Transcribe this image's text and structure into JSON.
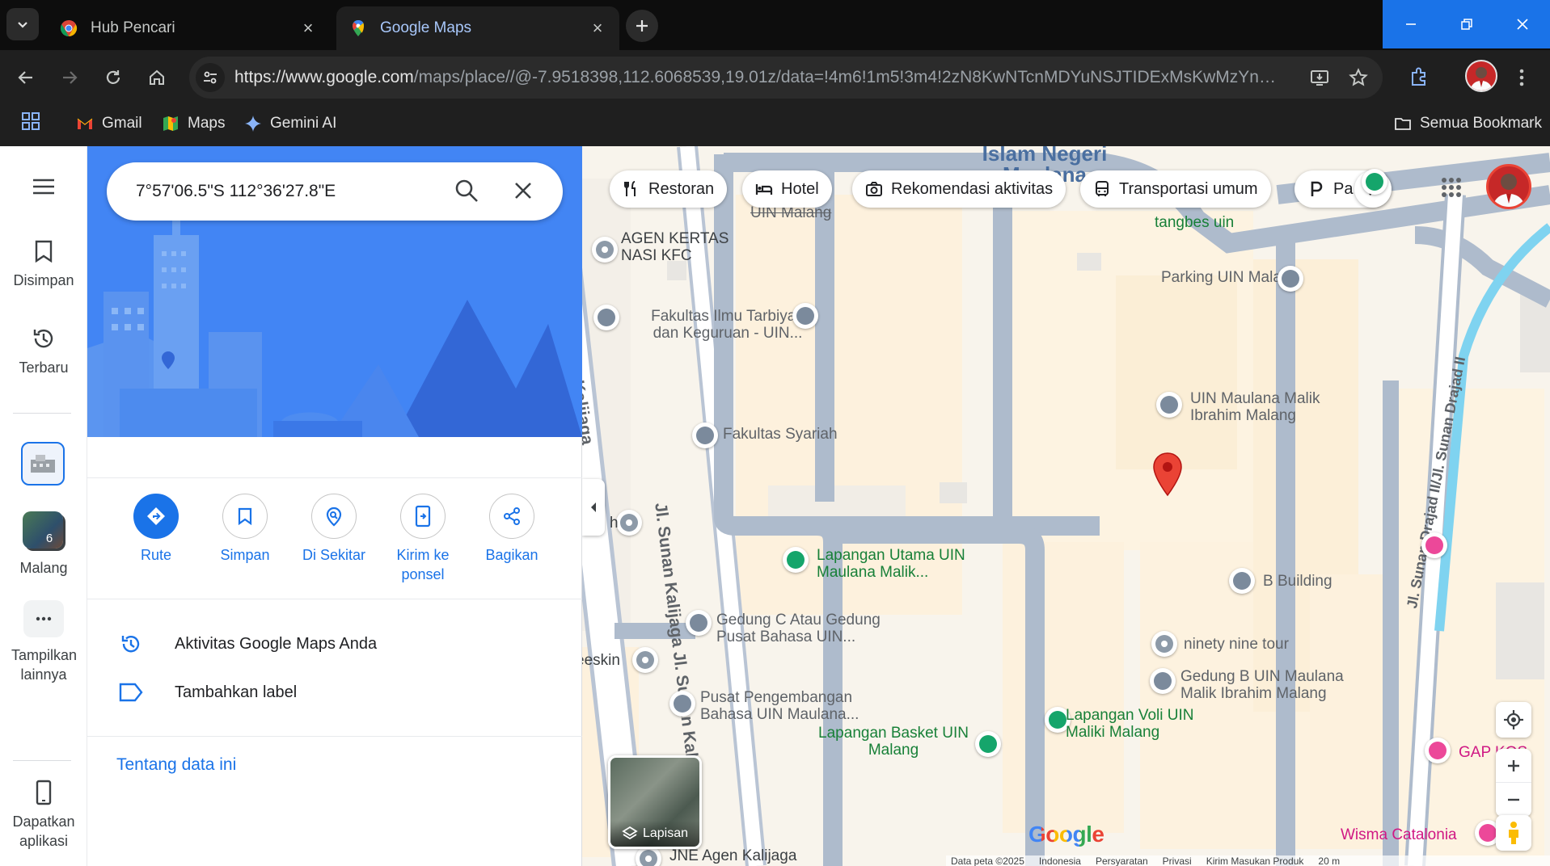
{
  "browser": {
    "tabs": [
      {
        "title": "Hub Pencari",
        "active": false
      },
      {
        "title": "Google Maps",
        "active": true
      }
    ],
    "url_host": "https://www.google.com",
    "url_path": "/maps/place//@-7.9518398,112.6068539,19.01z/data=!4m6!1m5!3m4!2zN8KwNTcnMDYuNSJTIDExMsKwMzYnMjc...",
    "bookmarks": [
      {
        "label": "Gmail",
        "icon": "gmail-icon"
      },
      {
        "label": "Maps",
        "icon": "maps-icon"
      },
      {
        "label": "Gemini AI",
        "icon": "gemini-icon"
      }
    ],
    "all_bookmarks_label": "Semua Bookmark"
  },
  "rail": {
    "saved": "Disimpan",
    "recent": "Terbaru",
    "malang": "Malang",
    "malang_count": "6",
    "more": "Tampilkan lainnya",
    "get_app": "Dapatkan aplikasi"
  },
  "panel": {
    "search_value": "7°57'06.5\"S 112°36'27.8\"E",
    "actions": [
      "Rute",
      "Simpan",
      "Di Sekitar",
      "Kirim ke ponsel",
      "Bagikan"
    ],
    "rows": [
      "Aktivitas Google Maps Anda",
      "Tambahkan label"
    ],
    "about_link": "Tentang data ini"
  },
  "map": {
    "chips": [
      "Restoran",
      "Hotel",
      "Rekomendasi aktivitas",
      "Transportasi umum",
      "Pa"
    ],
    "roads": [
      "Jl. Sunan Kalijaga",
      "Jl. Sunan Kalijaga Jl. Sunan Kalijaga",
      "Jl. Sunan Drajad II/Jl. Sunan Drajad II"
    ],
    "places": [
      {
        "name": "Islam Negeri Maulana",
        "kind": "area"
      },
      {
        "name": "UIN Malang",
        "kind": "edu"
      },
      {
        "name": "tangbes uin",
        "kind": "green"
      },
      {
        "name": "AGEN KERTAS NASI KFC",
        "kind": "gray"
      },
      {
        "name": "Parking UIN Malang",
        "kind": "edu"
      },
      {
        "name": "Fakultas Ilmu Tarbiyah dan Keguruan - UIN...",
        "kind": "edu"
      },
      {
        "name": "UIN Maulana Malik Ibrahim Malang",
        "kind": "edu"
      },
      {
        "name": "Fakultas Syariah",
        "kind": "edu"
      },
      {
        "name": "Lapangan Utama UIN Maulana Malik...",
        "kind": "green"
      },
      {
        "name": "B Building",
        "kind": "edu"
      },
      {
        "name": "Gedung C Atau Gedung Pusat Bahasa UIN...",
        "kind": "edu"
      },
      {
        "name": "ninety nine tour",
        "kind": "gray"
      },
      {
        "name": "Gedung B UIN Maulana Malik Ibrahim Malang",
        "kind": "edu"
      },
      {
        "name": "Pusat Pengembangan Bahasa UIN Maulana...",
        "kind": "edu"
      },
      {
        "name": "Lapangan Voli UIN Maliki Malang",
        "kind": "green"
      },
      {
        "name": "Lapangan Basket UIN Malang",
        "kind": "green"
      },
      {
        "name": "eeskin",
        "kind": "gray"
      },
      {
        "name": "JNE Agen Kalijaga",
        "kind": "gray"
      },
      {
        "name": "GAP KOS",
        "kind": "pink"
      },
      {
        "name": "Wisma Catalonia",
        "kind": "pink"
      },
      {
        "name": "h",
        "kind": "gray"
      }
    ],
    "layers_label": "Lapisan",
    "google_logo": "Google",
    "footer": [
      "Data peta ©2025",
      "Indonesia",
      "Persyaratan",
      "Privasi",
      "Kirim Masukan Produk",
      "20 m"
    ]
  }
}
